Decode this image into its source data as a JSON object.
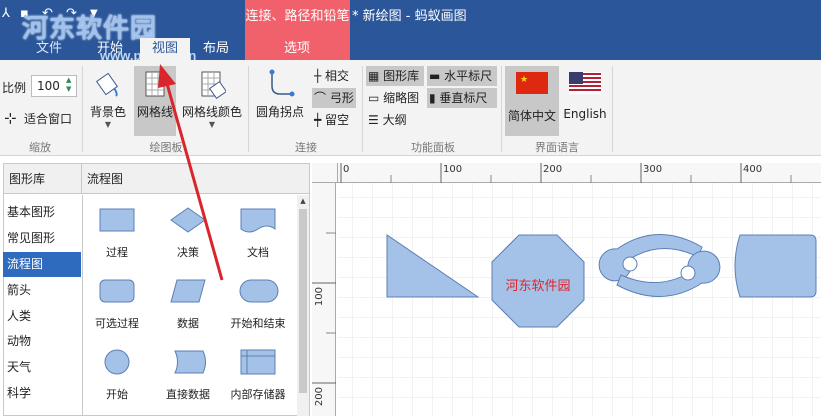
{
  "window": {
    "watermark": "河东软件园",
    "watermark_url": "www.pc0359.cn",
    "context_title": "连接、路径和铅笔",
    "doc_title": "* 新绘图 - 蚂蚁画图"
  },
  "tabs": [
    {
      "label": "文件"
    },
    {
      "label": "开始"
    },
    {
      "label": "视图"
    },
    {
      "label": "布局"
    },
    {
      "label": "选项"
    }
  ],
  "ribbon": {
    "zoom": {
      "label": "比例",
      "value": "100",
      "fit_label": "适合窗口",
      "group": "缩放"
    },
    "canvas_group": {
      "background": "背景色",
      "grid": "网格线",
      "grid_color": "网格线颜色",
      "group": "绘图板"
    },
    "connect_group": {
      "round": "圆角拐点",
      "intersect": "相交",
      "arc": "弓形",
      "gap": "留空",
      "group": "连接"
    },
    "panel_group": {
      "library": "图形库",
      "thumbnail": "缩略图",
      "outline": "大纲",
      "h_ruler": "水平标尺",
      "v_ruler": "垂直标尺",
      "group": "功能面板"
    },
    "lang_group": {
      "zh": "简体中文",
      "en": "English",
      "group": "界面语言"
    }
  },
  "library": {
    "header_left": "图形库",
    "header_right": "流程图",
    "categories": [
      "基本图形",
      "常见图形",
      "流程图",
      "箭头",
      "人类",
      "动物",
      "天气",
      "科学"
    ],
    "selected": "流程图",
    "shapes": [
      "过程",
      "决策",
      "文档",
      "可选过程",
      "数据",
      "开始和结束",
      "开始",
      "直接数据",
      "内部存储器"
    ]
  },
  "canvas": {
    "ruler_h": [
      "0",
      "100",
      "200",
      "300",
      "400"
    ],
    "ruler_v": [
      "100",
      "200"
    ],
    "octagon_text": "河东软件园"
  },
  "colors": {
    "title_bg": "#2b579a",
    "context_bg": "#f0616b",
    "shape_fill": "#a4c2e8",
    "shape_stroke": "#5b7fb5",
    "octagon_text": "#e0242c",
    "arrow": "#d9262c"
  }
}
